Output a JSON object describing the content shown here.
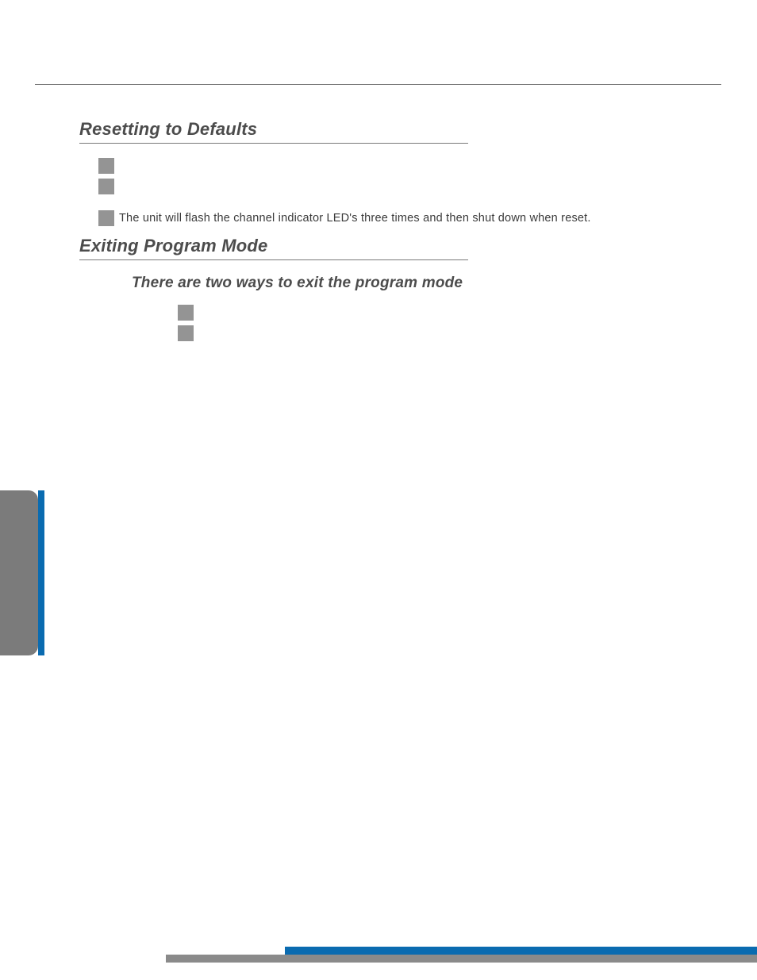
{
  "sections": {
    "resetting": {
      "title": "Resetting to Defaults",
      "note": "The unit will flash the channel indicator LED's three times and then shut down when reset."
    },
    "exiting": {
      "title": "Exiting Program Mode",
      "subtitle": "There are two ways to exit the program mode"
    }
  }
}
